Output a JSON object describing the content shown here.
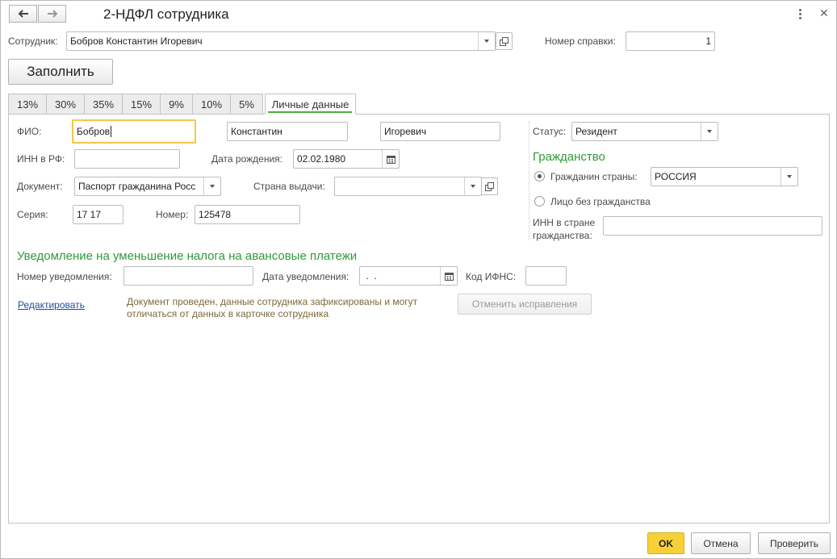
{
  "header": {
    "title": "2-НДФЛ сотрудника"
  },
  "employee": {
    "label": "Сотрудник:",
    "value": "Бобров Константин Игоревич"
  },
  "certificate": {
    "label": "Номер справки:",
    "value": "1"
  },
  "fill_button": "Заполнить",
  "tabs": [
    {
      "label": "13%"
    },
    {
      "label": "30%"
    },
    {
      "label": "35%"
    },
    {
      "label": "15%"
    },
    {
      "label": "9%"
    },
    {
      "label": "10%"
    },
    {
      "label": "5%"
    },
    {
      "label": "Личные данные"
    }
  ],
  "personal": {
    "fio_label": "ФИО:",
    "last_name": "Бобров",
    "first_name": "Константин",
    "middle_name": "Игоревич",
    "inn_label": "ИНН в РФ:",
    "inn_value": "",
    "birth_label": "Дата рождения:",
    "birth_value": "02.02.1980",
    "doc_label": "Документ:",
    "doc_value": "Паспорт гражданина Росс",
    "country_label": "Страна выдачи:",
    "country_value": "",
    "series_label": "Серия:",
    "series_value": "17 17",
    "number_label": "Номер:",
    "number_value": "125478"
  },
  "status": {
    "label": "Статус:",
    "value": "Резидент"
  },
  "citizenship": {
    "heading": "Гражданство",
    "citizen_label": "Гражданин страны:",
    "citizen_country": "РОССИЯ",
    "stateless_label": "Лицо без гражданства",
    "foreign_inn_label_1": "ИНН в стране",
    "foreign_inn_label_2": "гражданства:",
    "foreign_inn_value": ""
  },
  "notice": {
    "heading": "Уведомление на уменьшение налога на авансовые платежи",
    "number_label": "Номер уведомления:",
    "number_value": "",
    "date_label": "Дата уведомления:",
    "date_value": " .  .",
    "ifns_label": "Код ИФНС:",
    "ifns_value": ""
  },
  "edit_link": "Редактировать",
  "info_line_1": "Документ проведен, данные сотрудника зафиксированы и могут",
  "info_line_2": "отличаться от данных в карточке сотрудника",
  "cancel_fix_button": "Отменить исправления",
  "footer": {
    "ok": "OK",
    "cancel": "Отмена",
    "check": "Проверить"
  },
  "colors": {
    "accent_yellow": "#f5c64b",
    "heading_green": "#2e9a3a",
    "link_blue": "#1a4e9c",
    "info_olive": "#7a6a3a"
  }
}
